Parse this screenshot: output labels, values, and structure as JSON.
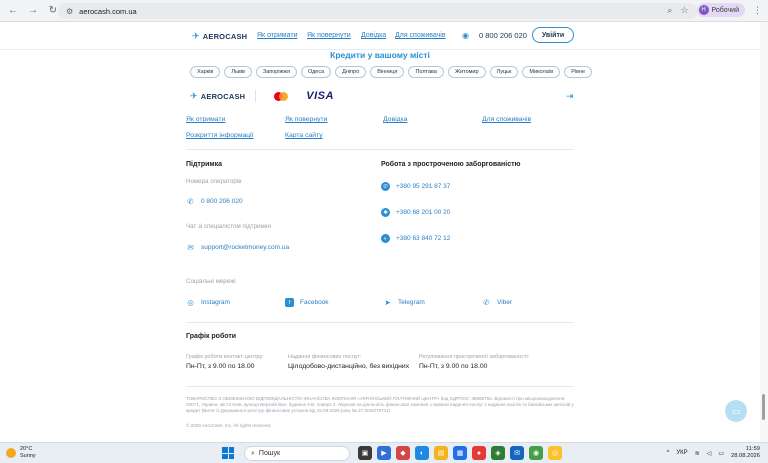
{
  "browser": {
    "url": "aerocash.com.ua",
    "profile_initial": "Н",
    "profile_label": "Робочий"
  },
  "header": {
    "logo": "AEROCASH",
    "nav": [
      "Як отримати",
      "Як повернути",
      "Довідка",
      "Для споживачів"
    ],
    "phone": "0 800 206 020",
    "login": "Увійти"
  },
  "cities": {
    "title": "Кредити у вашому місті",
    "items": [
      "Харків",
      "Львів",
      "Запоріжжя",
      "Одеса",
      "Дніпро",
      "Вінниця",
      "Полтава",
      "Житомир",
      "Луцьк",
      "Миколаїв",
      "Рівне"
    ]
  },
  "payments": {
    "logo": "AEROCASH",
    "visa": "VISA"
  },
  "footer_links": {
    "row1": [
      "Як отримати",
      "Як повернути",
      "Довідка",
      "Для споживачів"
    ],
    "row2": [
      "Розкриття інформації",
      "Карта сайту"
    ]
  },
  "support": {
    "title": "Підтримка",
    "operators_label": "Номера операторів",
    "operator_phone": "0 800 206 020",
    "chat_label": "Чат зі спеціалістом підтримки",
    "email": "support@rocketmoney.com.ua"
  },
  "overdue": {
    "title": "Робота з простроченою заборгованістю",
    "phones": [
      "+380 95 291 87 37",
      "+380 68 201 00 20",
      "+380 63 840 72 12"
    ]
  },
  "social": {
    "label": "Соціальні мережі",
    "items": [
      "Instagram",
      "Facebook",
      "Telegram",
      "Viber"
    ]
  },
  "schedule": {
    "title": "Графік роботи",
    "items": [
      {
        "label": "Графік роботи контакт-центру:",
        "value": "Пн-Пт, з 9.00 по 18.00"
      },
      {
        "label": "Надання фінансових послуг:",
        "value": "Цілодобово-дистанційно, без вихідних"
      },
      {
        "label": "Регулювання простроченої заборгованості:",
        "value": "Пн-Пт, з 9.00 по 18.00"
      }
    ]
  },
  "legal": "ТОВАРИСТВО З ОБМЕЖЕНОЮ ВІДПОВІДАЛЬНІСТЮ ФІНАНСОВА КОМПАНІЯ «УКРАЇНСЬКИЙ ПЛАТІЖНИЙ ЦЕНТР» Код ЄДРПОУ: 38898755. Відомості про місцезнаходження: 04071, Україна, місто Київ, вулиця Верхній Вал, будинок 4-В, поверх 2. Ліцензія на діяльність фінансової компанії з правом надання послуг з надання коштів та банківських металів у кредит (Витяг із Державного реєстру фінансових установ від 15.09.2025 року № 27-2034/70711)",
  "copyright": "© 2026 AeroCash, Inc. All rights reserved.",
  "taskbar": {
    "temp": "20°C",
    "weather": "Sunny",
    "search": "Пошук",
    "lang": "УКР",
    "time": "11:59",
    "date": "28.08.2026"
  }
}
